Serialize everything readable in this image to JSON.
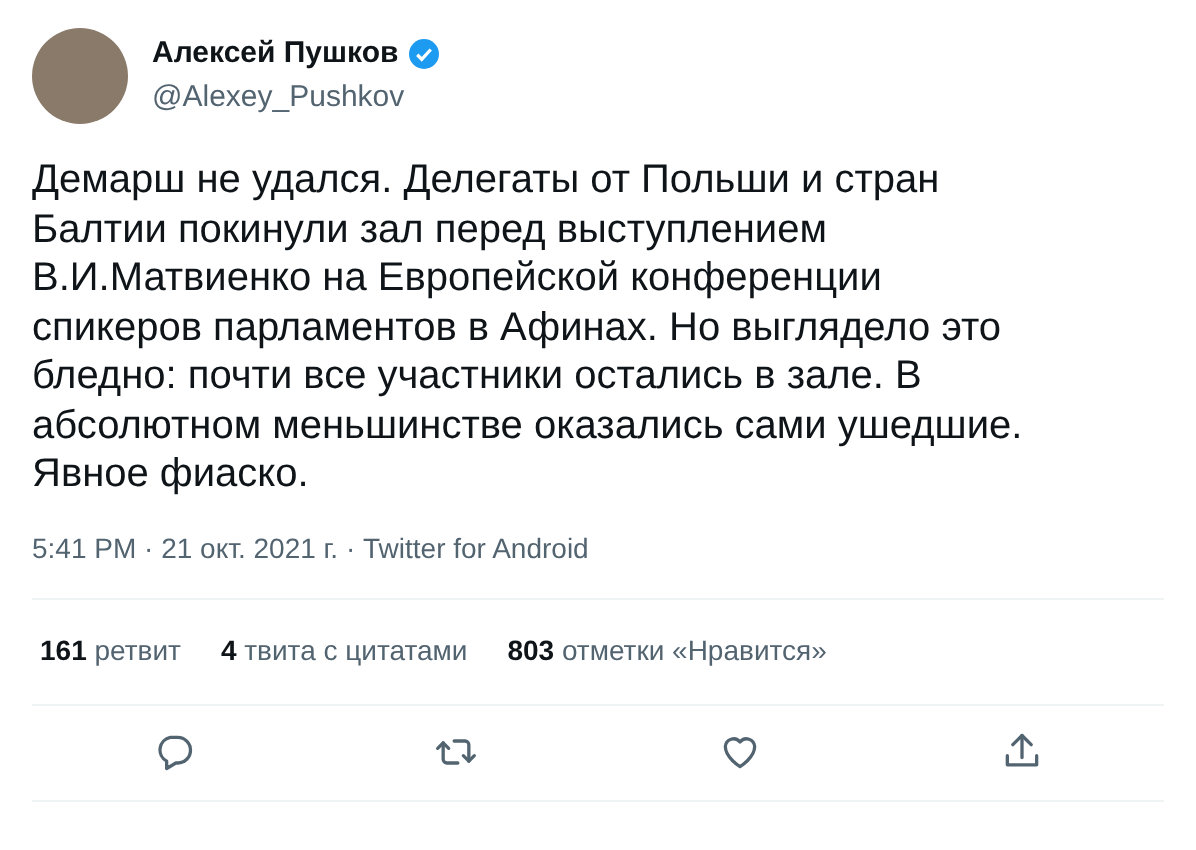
{
  "author": {
    "name": "Алексей Пушков",
    "handle": "@Alexey_Pushkov",
    "verified": true
  },
  "text": "Демарш не удался. Делегаты от Польши и стран Балтии покинули зал перед выступлением В.И.Матвиенко на Европейской конференции спикеров парламентов в Афинах. Но выглядело это бледно: почти все участники остались в зале. В абсолютном меньшинстве оказались сами ушедшие. Явное фиаско.",
  "meta": "5:41 PM · 21 окт. 2021 г. · Twitter for Android",
  "stats": [
    "**161** ретвит",
    "**4** твита с цитатами",
    "**803** отметки «Нравится»"
  ],
  "actions": [
    {
      "kind": "reply"
    },
    {
      "kind": "retweet"
    },
    {
      "kind": "like"
    },
    {
      "kind": "share"
    }
  ]
}
